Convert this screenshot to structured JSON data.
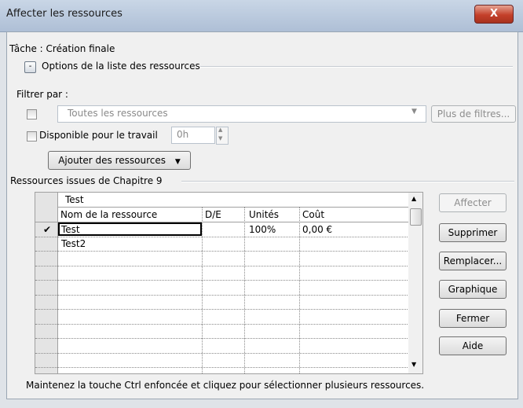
{
  "window": {
    "title": "Affecter les ressources",
    "close_glyph": "X"
  },
  "task_label": "Tâche : Création finale",
  "options_toggle": {
    "glyph": "-",
    "label": "Options de la liste des ressources"
  },
  "filter": {
    "label": "Filtrer par :",
    "combo_value": "Toutes les ressources",
    "more_filters_label": "Plus de filtres..."
  },
  "available": {
    "label": "Disponible pour le travail",
    "value": "0h"
  },
  "add_resources_label": "Ajouter des ressources",
  "group_label": "Ressources issues de Chapitre 9",
  "grid": {
    "edit_value": "Test",
    "columns": [
      "Nom de la ressource",
      "D/E",
      "Unités",
      "Coût"
    ],
    "rows": [
      {
        "check": "✔",
        "name": "Test",
        "de": "",
        "units": "100%",
        "cost": "0,00 €"
      },
      {
        "check": "",
        "name": "Test2",
        "de": "",
        "units": "",
        "cost": ""
      }
    ]
  },
  "buttons": {
    "assign": "Affecter",
    "remove": "Supprimer",
    "replace": "Remplacer...",
    "graph": "Graphique",
    "close": "Fermer",
    "help": "Aide"
  },
  "hint": "Maintenez la touche Ctrl enfoncée et cliquez pour sélectionner plusieurs ressources."
}
